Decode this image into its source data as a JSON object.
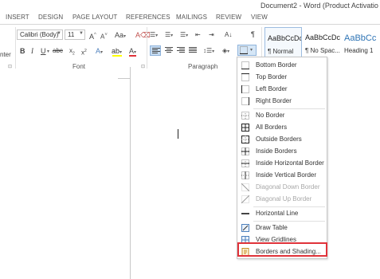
{
  "window": {
    "title": "Document2 - Word (Product Activatio"
  },
  "tabs": [
    "INSERT",
    "DESIGN",
    "PAGE LAYOUT",
    "REFERENCES",
    "MAILINGS",
    "REVIEW",
    "VIEW"
  ],
  "ribbon": {
    "left_clip_label": "nter",
    "font": {
      "name": "Calibri (Body)",
      "size": "11",
      "group_label": "Font"
    },
    "paragraph": {
      "group_label": "Paragraph"
    },
    "styles": [
      {
        "sample": "AaBbCcDc",
        "name": "¶ Normal"
      },
      {
        "sample": "AaBbCcDc",
        "name": "¶ No Spac..."
      },
      {
        "sample": "AaBbCc",
        "name": "Heading 1"
      }
    ]
  },
  "borders_menu": {
    "items": [
      {
        "label": "Bottom Border",
        "enabled": true
      },
      {
        "label": "Top Border",
        "enabled": true
      },
      {
        "label": "Left Border",
        "enabled": true
      },
      {
        "label": "Right Border",
        "enabled": true
      },
      {
        "label": "No Border",
        "enabled": true
      },
      {
        "label": "All Borders",
        "enabled": true
      },
      {
        "label": "Outside Borders",
        "enabled": true
      },
      {
        "label": "Inside Borders",
        "enabled": true
      },
      {
        "label": "Inside Horizontal Border",
        "enabled": true
      },
      {
        "label": "Inside Vertical Border",
        "enabled": true
      },
      {
        "label": "Diagonal Down Border",
        "enabled": false
      },
      {
        "label": "Diagonal Up Border",
        "enabled": false
      },
      {
        "label": "Horizontal Line",
        "enabled": true
      },
      {
        "label": "Draw Table",
        "enabled": true
      },
      {
        "label": "View Gridlines",
        "enabled": true
      },
      {
        "label": "Borders and Shading...",
        "enabled": true
      }
    ]
  },
  "colors": {
    "highlight_box": "#e0333a",
    "accent": "#2e74b5"
  }
}
